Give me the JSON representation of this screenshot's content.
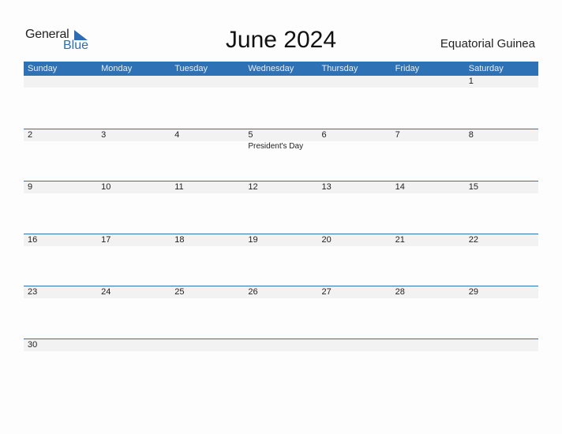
{
  "brand": {
    "line1": "General",
    "line2": "Blue",
    "color": "#2e6db4"
  },
  "title": "June 2024",
  "country": "Equatorial Guinea",
  "colors": {
    "header_bg": "#2e72b5",
    "date_strip": "#f2f2f2",
    "separator": "#2e72b5"
  },
  "weekdays": [
    "Sunday",
    "Monday",
    "Tuesday",
    "Wednesday",
    "Thursday",
    "Friday",
    "Saturday"
  ],
  "weeks": [
    {
      "days": [
        {
          "num": ""
        },
        {
          "num": ""
        },
        {
          "num": ""
        },
        {
          "num": ""
        },
        {
          "num": ""
        },
        {
          "num": ""
        },
        {
          "num": "1"
        }
      ]
    },
    {
      "days": [
        {
          "num": "2"
        },
        {
          "num": "3"
        },
        {
          "num": "4"
        },
        {
          "num": "5",
          "event": "President's Day"
        },
        {
          "num": "6"
        },
        {
          "num": "7"
        },
        {
          "num": "8"
        }
      ]
    },
    {
      "days": [
        {
          "num": "9"
        },
        {
          "num": "10"
        },
        {
          "num": "11"
        },
        {
          "num": "12"
        },
        {
          "num": "13"
        },
        {
          "num": "14"
        },
        {
          "num": "15"
        }
      ]
    },
    {
      "days": [
        {
          "num": "16"
        },
        {
          "num": "17"
        },
        {
          "num": "18"
        },
        {
          "num": "19"
        },
        {
          "num": "20"
        },
        {
          "num": "21"
        },
        {
          "num": "22"
        }
      ]
    },
    {
      "days": [
        {
          "num": "23"
        },
        {
          "num": "24"
        },
        {
          "num": "25"
        },
        {
          "num": "26"
        },
        {
          "num": "27"
        },
        {
          "num": "28"
        },
        {
          "num": "29"
        }
      ]
    },
    {
      "days": [
        {
          "num": "30"
        },
        {
          "num": ""
        },
        {
          "num": ""
        },
        {
          "num": ""
        },
        {
          "num": ""
        },
        {
          "num": ""
        },
        {
          "num": ""
        }
      ]
    }
  ]
}
